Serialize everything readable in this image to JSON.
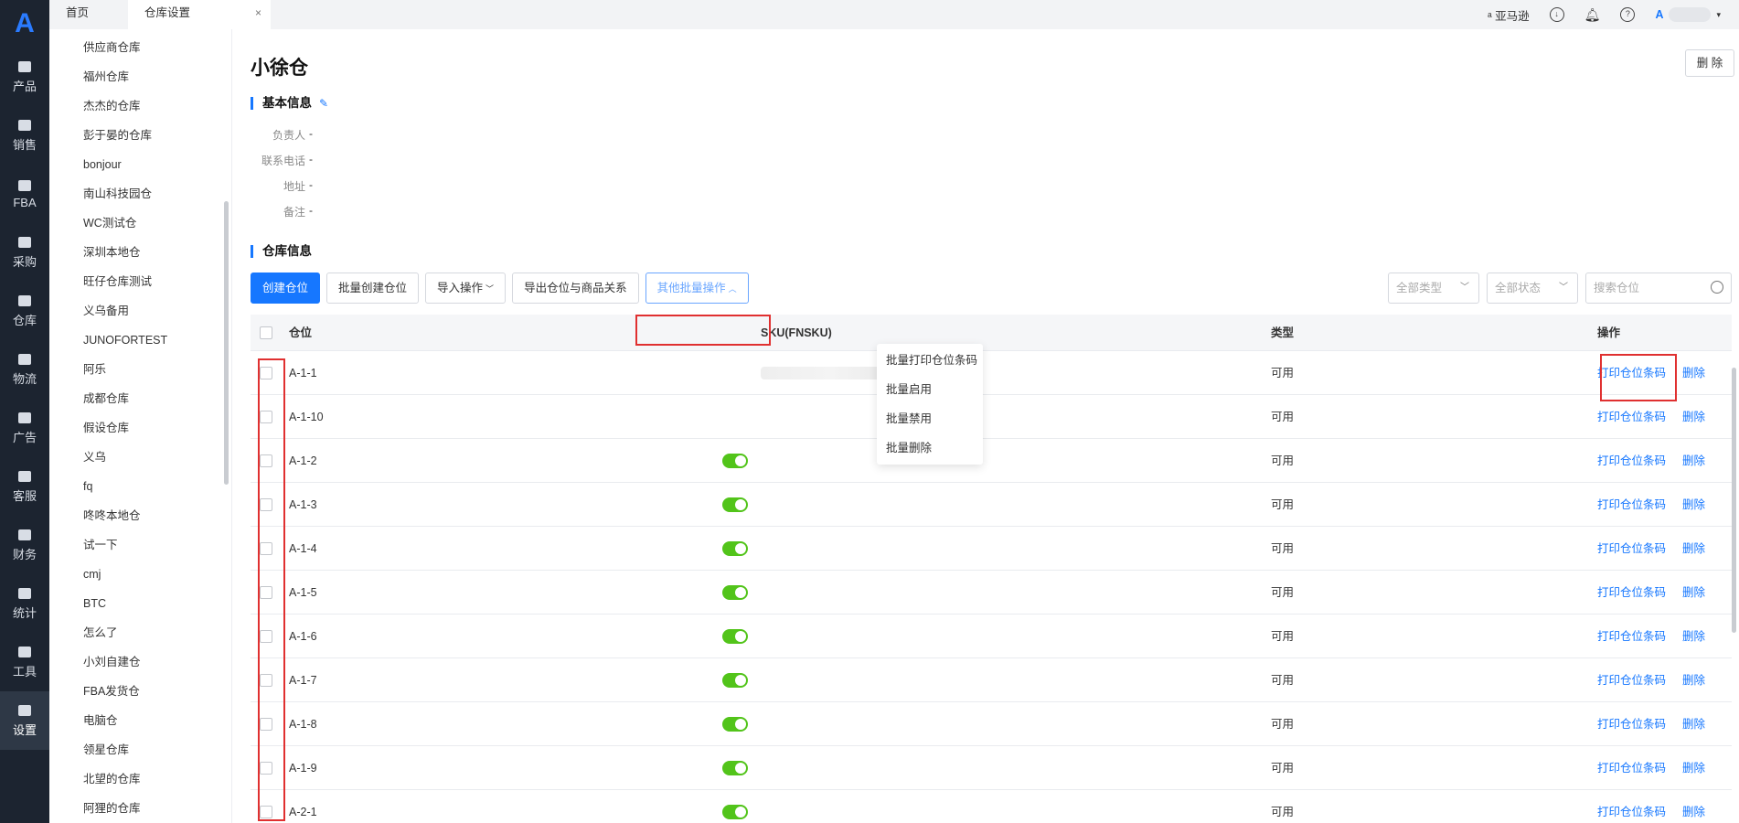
{
  "topbar": {
    "tabs": [
      {
        "label": "首页"
      },
      {
        "label": "仓库设置",
        "close": "×"
      }
    ],
    "marketplace": "亚马逊",
    "user_initial": "A"
  },
  "rail": {
    "logo": "A",
    "items": [
      {
        "label": "产品"
      },
      {
        "label": "销售"
      },
      {
        "label": "FBA"
      },
      {
        "label": "采购"
      },
      {
        "label": "仓库"
      },
      {
        "label": "物流"
      },
      {
        "label": "广告"
      },
      {
        "label": "客服"
      },
      {
        "label": "财务"
      },
      {
        "label": "统计"
      },
      {
        "label": "工具"
      },
      {
        "label": "设置"
      }
    ]
  },
  "sidebar": {
    "items": [
      "供应商仓库",
      "福州仓库",
      "杰杰的仓库",
      "彭于晏的仓库",
      "bonjour",
      "南山科技园仓",
      "WC测试仓",
      "深圳本地仓",
      "旺仔仓库测试",
      "义乌备用",
      "JUNOFORTEST",
      "阿乐",
      "成都仓库",
      "假设仓库",
      "义乌",
      "fq",
      "咚咚本地仓",
      "试一下",
      "cmj",
      "BTC",
      "怎么了",
      "小刘自建仓",
      "FBA发货仓",
      "电脑仓",
      "领星仓库",
      "北望的仓库",
      "阿狸的仓库"
    ]
  },
  "main": {
    "title": "小徐仓",
    "delete_label": "删 除",
    "basic_info": {
      "heading": "基本信息",
      "fields": [
        {
          "label": "负责人",
          "value": "-"
        },
        {
          "label": "联系电话",
          "value": "-"
        },
        {
          "label": "地址",
          "value": "-"
        },
        {
          "label": "备注",
          "value": "-"
        }
      ]
    },
    "warehouse_info": {
      "heading": "仓库信息"
    },
    "toolbar": {
      "create": "创建仓位",
      "batch_create": "批量创建仓位",
      "import": "导入操作",
      "export": "导出仓位与商品关系",
      "other": "其他批量操作"
    },
    "filters": {
      "type": "全部类型",
      "status": "全部状态",
      "search_placeholder": "搜索仓位"
    },
    "dropdown": [
      "批量打印仓位条码",
      "批量启用",
      "批量禁用",
      "批量删除"
    ],
    "table": {
      "headers": {
        "location": "仓位",
        "sku": "SKU(FNSKU)",
        "type": "类型",
        "ops": "操作"
      },
      "op_print": "打印仓位条码",
      "op_delete": "删除",
      "rows": [
        {
          "loc": "A-1-1",
          "type": "可用"
        },
        {
          "loc": "A-1-10",
          "type": "可用"
        },
        {
          "loc": "A-1-2",
          "type": "可用"
        },
        {
          "loc": "A-1-3",
          "type": "可用"
        },
        {
          "loc": "A-1-4",
          "type": "可用"
        },
        {
          "loc": "A-1-5",
          "type": "可用"
        },
        {
          "loc": "A-1-6",
          "type": "可用"
        },
        {
          "loc": "A-1-7",
          "type": "可用"
        },
        {
          "loc": "A-1-8",
          "type": "可用"
        },
        {
          "loc": "A-1-9",
          "type": "可用"
        },
        {
          "loc": "A-2-1",
          "type": "可用"
        }
      ]
    }
  }
}
